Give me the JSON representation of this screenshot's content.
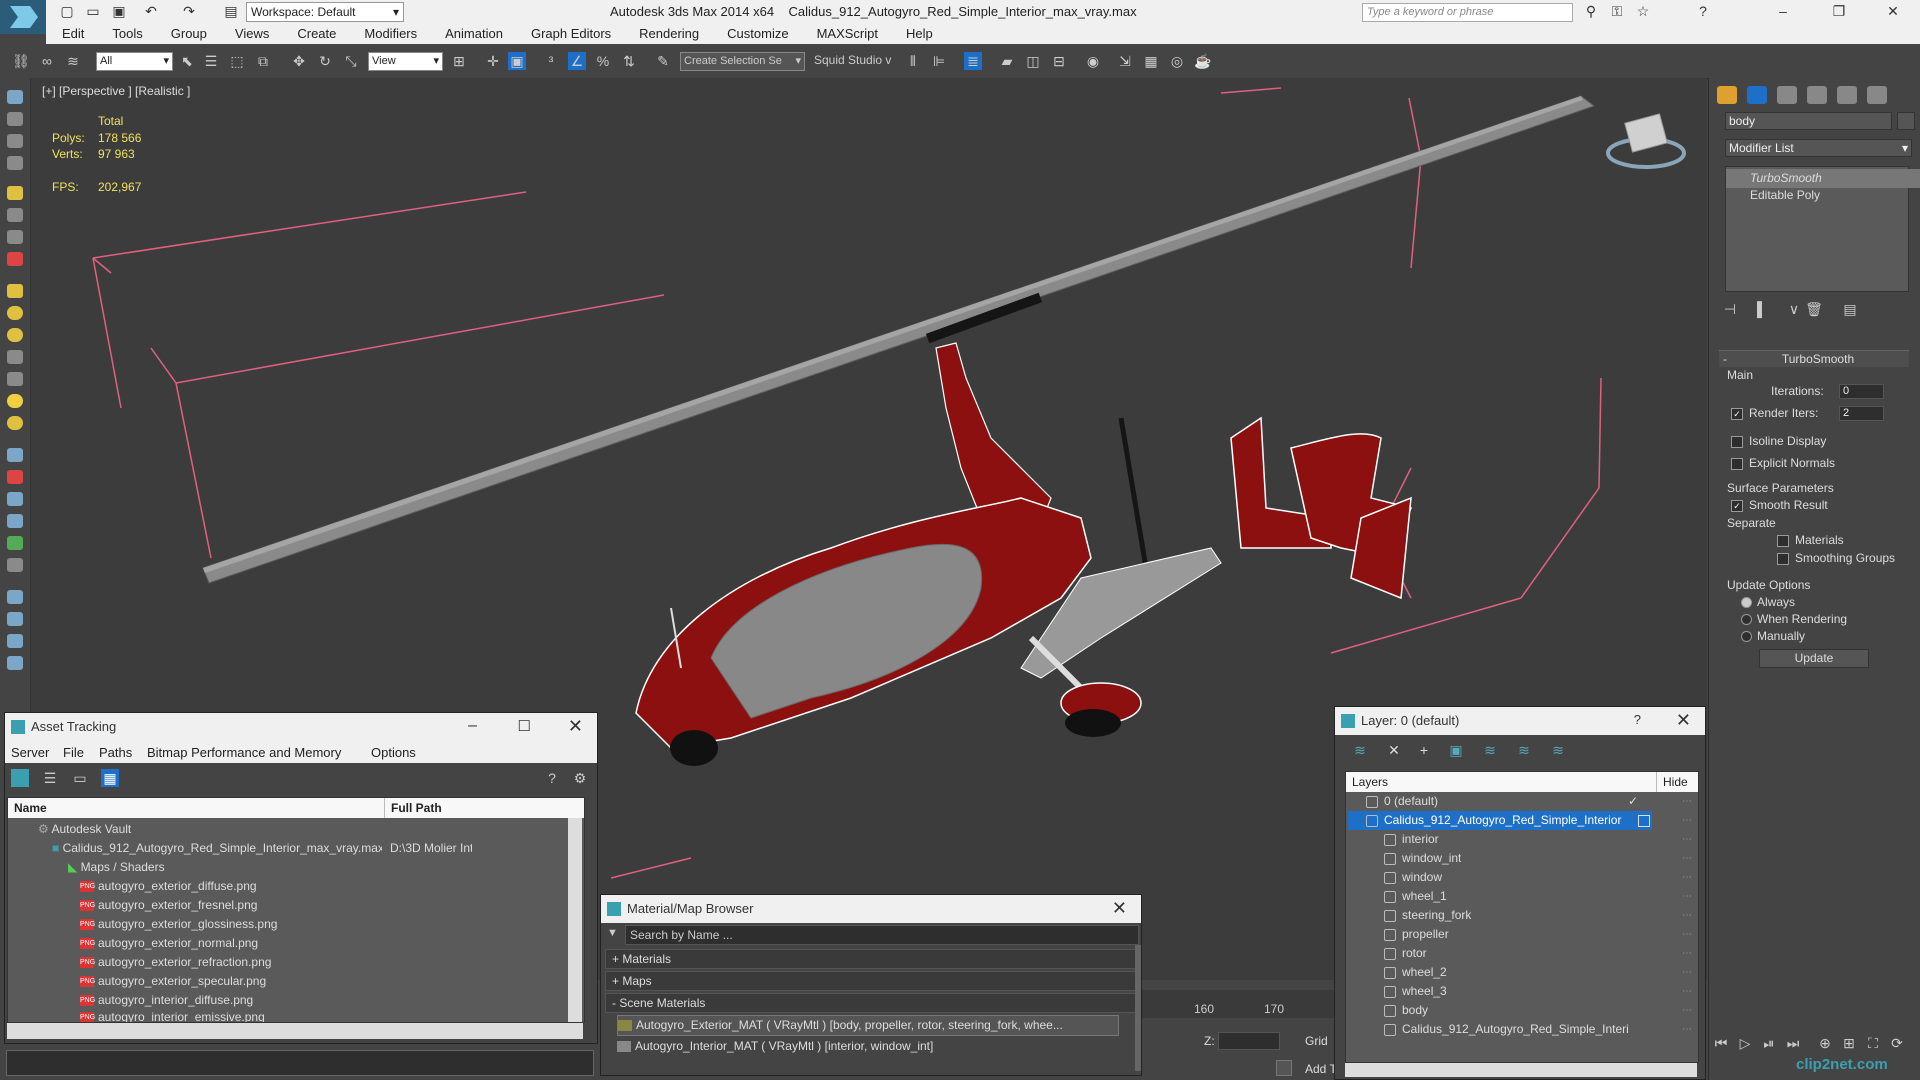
{
  "titlebar": {
    "app": "Autodesk 3ds Max  2014 x64",
    "file": "Calidus_912_Autogyro_Red_Simple_Interior_max_vray.max",
    "workspace": "Workspace: Default",
    "search_placeholder": "Type a keyword or phrase"
  },
  "menu": [
    "Edit",
    "Tools",
    "Group",
    "Views",
    "Create",
    "Modifiers",
    "Animation",
    "Graph Editors",
    "Rendering",
    "Customize",
    "MAXScript",
    "Help"
  ],
  "toolbar": {
    "filter": "All",
    "ref_coord": "View",
    "selection_set": "Create Selection Se",
    "squid": "Squid Studio v"
  },
  "viewport": {
    "label": "[+] [Perspective ] [Realistic ]",
    "stats": {
      "total_label": "Total",
      "polys_label": "Polys:",
      "polys": "178 566",
      "verts_label": "Verts:",
      "verts": "97 963",
      "fps_label": "FPS:",
      "fps": "202,967"
    }
  },
  "command_panel": {
    "object_name": "body",
    "modifier_list": "Modifier List",
    "stack": [
      "TurboSmooth",
      "Editable Poly"
    ],
    "rollout_title": "TurboSmooth",
    "main_label": "Main",
    "iterations_label": "Iterations:",
    "iterations": "0",
    "render_iters_label": "Render Iters:",
    "render_iters": "2",
    "isoline": "Isoline Display",
    "explicit_normals": "Explicit Normals",
    "surface_params": "Surface Parameters",
    "smooth_result": "Smooth Result",
    "separate": "Separate",
    "materials": "Materials",
    "smoothing_groups": "Smoothing Groups",
    "update_options": "Update Options",
    "always": "Always",
    "when_rendering": "When Rendering",
    "manually": "Manually",
    "update_button": "Update"
  },
  "asset_tracking": {
    "title": "Asset Tracking",
    "menu": [
      "Server",
      "File",
      "Paths",
      "Bitmap Performance and Memory",
      "Options"
    ],
    "col_name": "Name",
    "col_path": "Full Path",
    "vault": "Autodesk Vault",
    "file": "Calidus_912_Autogyro_Red_Simple_Interior_max_vray.max",
    "file_path": "D:\\3D Molier Int",
    "maps_group": "Maps / Shaders",
    "maps": [
      "autogyro_exterior_diffuse.png",
      "autogyro_exterior_fresnel.png",
      "autogyro_exterior_glossiness.png",
      "autogyro_exterior_normal.png",
      "autogyro_exterior_refraction.png",
      "autogyro_exterior_specular.png",
      "autogyro_interior_diffuse.png",
      "autogyro_interior_emissive.png"
    ]
  },
  "material_browser": {
    "title": "Material/Map Browser",
    "search_placeholder": "Search by Name ...",
    "materials": "+ Materials",
    "maps": "+ Maps",
    "scene_materials": "- Scene Materials",
    "items": [
      "Autogyro_Exterior_MAT ( VRayMtl ) [body, propeller, rotor, steering_fork, whee...",
      "Autogyro_Interior_MAT ( VRayMtl ) [interior, window_int]"
    ]
  },
  "layers": {
    "title": "Layer: 0 (default)",
    "col_layers": "Layers",
    "col_hide": "Hide",
    "default_layer": "0 (default)",
    "active_layer": "Calidus_912_Autogyro_Red_Simple_Interior",
    "objects": [
      "interior",
      "window_int",
      "window",
      "wheel_1",
      "steering_fork",
      "propeller",
      "rotor",
      "wheel_2",
      "wheel_3",
      "body",
      "Calidus_912_Autogyro_Red_Simple_Interi"
    ]
  },
  "timeline": {
    "tick_160": "160",
    "tick_170": "170",
    "z_label": "Z:",
    "grid_label": "Grid",
    "add_label": "Add T"
  },
  "watermark": "clip2net.com",
  "colors": {
    "accent": "#1e6fc8",
    "hull_red": "#8c1010",
    "wire": "#ffffff",
    "bbox": "#e06080",
    "stats": "#f0e060"
  }
}
